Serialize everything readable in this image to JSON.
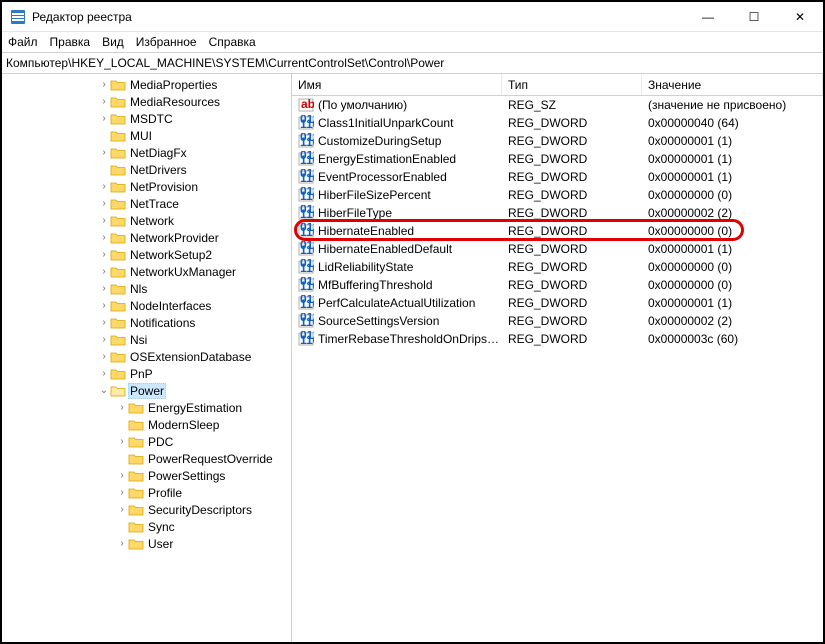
{
  "window": {
    "title": "Редактор реестра"
  },
  "menu": {
    "file": "Файл",
    "edit": "Правка",
    "view": "Вид",
    "fav": "Избранное",
    "help": "Справка"
  },
  "address": "Компьютер\\HKEY_LOCAL_MACHINE\\SYSTEM\\CurrentControlSet\\Control\\Power",
  "winctrl": {
    "min": "—",
    "max": "☐",
    "close": "✕"
  },
  "cols": {
    "name": "Имя",
    "type": "Тип",
    "value": "Значение"
  },
  "tree": [
    {
      "ind": 96,
      "tw": ">",
      "label": "MediaProperties"
    },
    {
      "ind": 96,
      "tw": ">",
      "label": "MediaResources"
    },
    {
      "ind": 96,
      "tw": ">",
      "label": "MSDTC"
    },
    {
      "ind": 96,
      "tw": "",
      "label": "MUI"
    },
    {
      "ind": 96,
      "tw": ">",
      "label": "NetDiagFx"
    },
    {
      "ind": 96,
      "tw": "",
      "label": "NetDrivers"
    },
    {
      "ind": 96,
      "tw": ">",
      "label": "NetProvision"
    },
    {
      "ind": 96,
      "tw": ">",
      "label": "NetTrace"
    },
    {
      "ind": 96,
      "tw": ">",
      "label": "Network"
    },
    {
      "ind": 96,
      "tw": ">",
      "label": "NetworkProvider"
    },
    {
      "ind": 96,
      "tw": ">",
      "label": "NetworkSetup2"
    },
    {
      "ind": 96,
      "tw": ">",
      "label": "NetworkUxManager"
    },
    {
      "ind": 96,
      "tw": ">",
      "label": "Nls"
    },
    {
      "ind": 96,
      "tw": ">",
      "label": "NodeInterfaces"
    },
    {
      "ind": 96,
      "tw": ">",
      "label": "Notifications"
    },
    {
      "ind": 96,
      "tw": ">",
      "label": "Nsi"
    },
    {
      "ind": 96,
      "tw": ">",
      "label": "OSExtensionDatabase"
    },
    {
      "ind": 96,
      "tw": ">",
      "label": "PnP"
    },
    {
      "ind": 96,
      "tw": "v",
      "label": "Power",
      "selected": true,
      "open": true
    },
    {
      "ind": 114,
      "tw": ">",
      "label": "EnergyEstimation"
    },
    {
      "ind": 114,
      "tw": "",
      "label": "ModernSleep"
    },
    {
      "ind": 114,
      "tw": ">",
      "label": "PDC"
    },
    {
      "ind": 114,
      "tw": "",
      "label": "PowerRequestOverride"
    },
    {
      "ind": 114,
      "tw": ">",
      "label": "PowerSettings"
    },
    {
      "ind": 114,
      "tw": ">",
      "label": "Profile"
    },
    {
      "ind": 114,
      "tw": ">",
      "label": "SecurityDescriptors"
    },
    {
      "ind": 114,
      "tw": "",
      "label": "Sync"
    },
    {
      "ind": 114,
      "tw": ">",
      "label": "User"
    }
  ],
  "values": [
    {
      "icon": "str",
      "name": "(По умолчанию)",
      "type": "REG_SZ",
      "value": "(значение не присвоено)"
    },
    {
      "icon": "bin",
      "name": "Class1InitialUnparkCount",
      "type": "REG_DWORD",
      "value": "0x00000040 (64)"
    },
    {
      "icon": "bin",
      "name": "CustomizeDuringSetup",
      "type": "REG_DWORD",
      "value": "0x00000001 (1)"
    },
    {
      "icon": "bin",
      "name": "EnergyEstimationEnabled",
      "type": "REG_DWORD",
      "value": "0x00000001 (1)"
    },
    {
      "icon": "bin",
      "name": "EventProcessorEnabled",
      "type": "REG_DWORD",
      "value": "0x00000001 (1)"
    },
    {
      "icon": "bin",
      "name": "HiberFileSizePercent",
      "type": "REG_DWORD",
      "value": "0x00000000 (0)"
    },
    {
      "icon": "bin",
      "name": "HiberFileType",
      "type": "REG_DWORD",
      "value": "0x00000002 (2)"
    },
    {
      "icon": "bin",
      "name": "HibernateEnabled",
      "type": "REG_DWORD",
      "value": "0x00000000 (0)",
      "hl": true
    },
    {
      "icon": "bin",
      "name": "HibernateEnabledDefault",
      "type": "REG_DWORD",
      "value": "0x00000001 (1)"
    },
    {
      "icon": "bin",
      "name": "LidReliabilityState",
      "type": "REG_DWORD",
      "value": "0x00000000 (0)"
    },
    {
      "icon": "bin",
      "name": "MfBufferingThreshold",
      "type": "REG_DWORD",
      "value": "0x00000000 (0)"
    },
    {
      "icon": "bin",
      "name": "PerfCalculateActualUtilization",
      "type": "REG_DWORD",
      "value": "0x00000001 (1)"
    },
    {
      "icon": "bin",
      "name": "SourceSettingsVersion",
      "type": "REG_DWORD",
      "value": "0x00000002 (2)"
    },
    {
      "icon": "bin",
      "name": "TimerRebaseThresholdOnDripsExit",
      "type": "REG_DWORD",
      "value": "0x0000003c (60)"
    }
  ]
}
